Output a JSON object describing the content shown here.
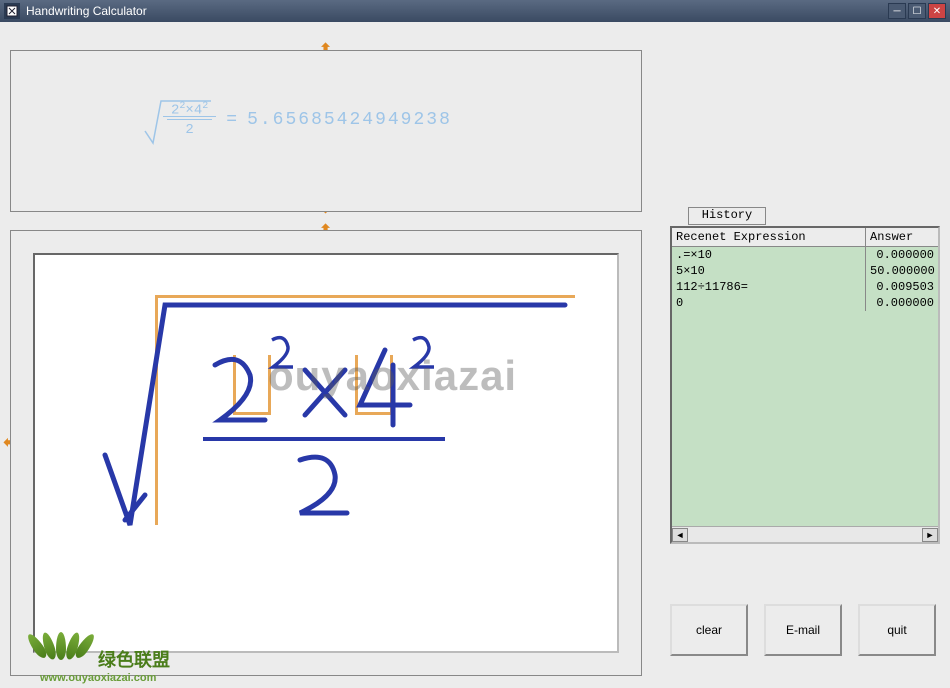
{
  "window": {
    "title": "Handwriting Calculator"
  },
  "preview": {
    "expression": "√((2² × 4²) / 2)",
    "numerator": "2²×4²",
    "denominator": "2",
    "equals": "=",
    "result": "5.65685424949238"
  },
  "handwriting": {
    "expression": "√((2² × 4²) / 2)",
    "numerator_char1": "2",
    "numerator_exp1": "2",
    "numerator_op": "×",
    "numerator_char2": "4",
    "numerator_exp2": "2",
    "denominator": "2"
  },
  "history": {
    "tab_label": "History",
    "headers": {
      "expression": "Recenet Expression",
      "answer": "Answer"
    },
    "rows": [
      {
        "expression": ".=×10",
        "answer": "0.000000"
      },
      {
        "expression": "5×10",
        "answer": "50.000000"
      },
      {
        "expression": "112÷11786=",
        "answer": "0.009503"
      },
      {
        "expression": "0",
        "answer": "0.000000"
      }
    ]
  },
  "buttons": {
    "clear": "clear",
    "email": "E-mail",
    "quit": "quit"
  },
  "watermark": "ouyaoxiazai",
  "footer": {
    "site_name": "绿色联盟",
    "site_url": "www.ouyaoxiazai.com"
  }
}
